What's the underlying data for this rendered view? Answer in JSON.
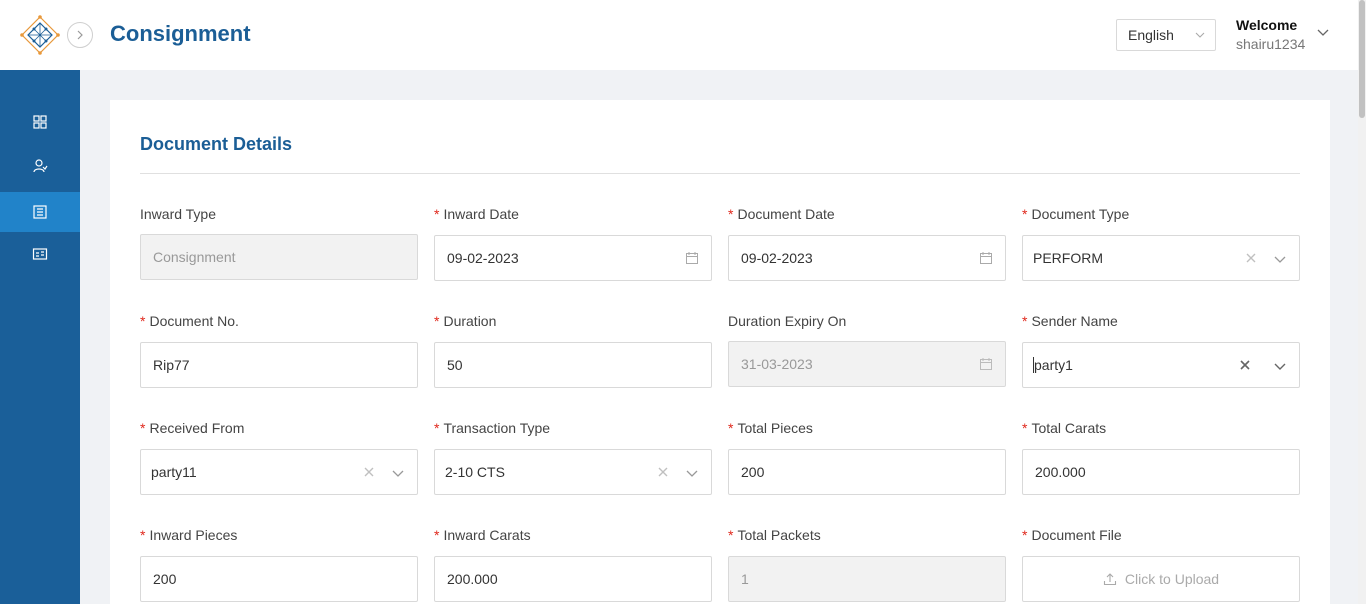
{
  "header": {
    "title": "Consignment",
    "language": "English",
    "welcome": "Welcome",
    "username": "shairu1234"
  },
  "sidebar": {
    "items": [
      {
        "icon": "dashboard-grid-icon",
        "active": false
      },
      {
        "icon": "users-icon",
        "active": false
      },
      {
        "icon": "document-list-icon",
        "active": true
      },
      {
        "icon": "id-card-icon",
        "active": false
      }
    ]
  },
  "section": {
    "title": "Document Details"
  },
  "fields": {
    "inward_type": {
      "label": "Inward Type",
      "value": "Consignment",
      "required": false,
      "disabled": true
    },
    "inward_date": {
      "label": "Inward Date",
      "value": "09-02-2023",
      "required": true
    },
    "document_date": {
      "label": "Document Date",
      "value": "09-02-2023",
      "required": true
    },
    "document_type": {
      "label": "Document Type",
      "value": "PERFORM",
      "required": true
    },
    "document_no": {
      "label": "Document No.",
      "value": "Rip77",
      "required": true
    },
    "duration": {
      "label": "Duration",
      "value": "50",
      "required": true
    },
    "duration_expiry": {
      "label": "Duration Expiry On",
      "value": "31-03-2023",
      "required": false,
      "disabled": true
    },
    "sender_name": {
      "label": "Sender Name",
      "value": "party1",
      "required": true
    },
    "received_from": {
      "label": "Received From",
      "value": "party11",
      "required": true
    },
    "transaction_type": {
      "label": "Transaction Type",
      "value": "2-10 CTS",
      "required": true
    },
    "total_pieces": {
      "label": "Total Pieces",
      "value": "200",
      "required": true
    },
    "total_carats": {
      "label": "Total Carats",
      "value": "200.000",
      "required": true
    },
    "inward_pieces": {
      "label": "Inward Pieces",
      "value": "200",
      "required": true
    },
    "inward_carats": {
      "label": "Inward Carats",
      "value": "200.000",
      "required": true
    },
    "total_packets": {
      "label": "Total Packets",
      "value": "1",
      "required": true,
      "disabled": true
    },
    "document_file": {
      "label": "Document File",
      "value": "Click to Upload",
      "required": true
    }
  },
  "colors": {
    "primary": "#1b5e96",
    "sidebar": "#1a5f99",
    "sidebar_active": "#2183c9",
    "required": "#e0281c"
  }
}
